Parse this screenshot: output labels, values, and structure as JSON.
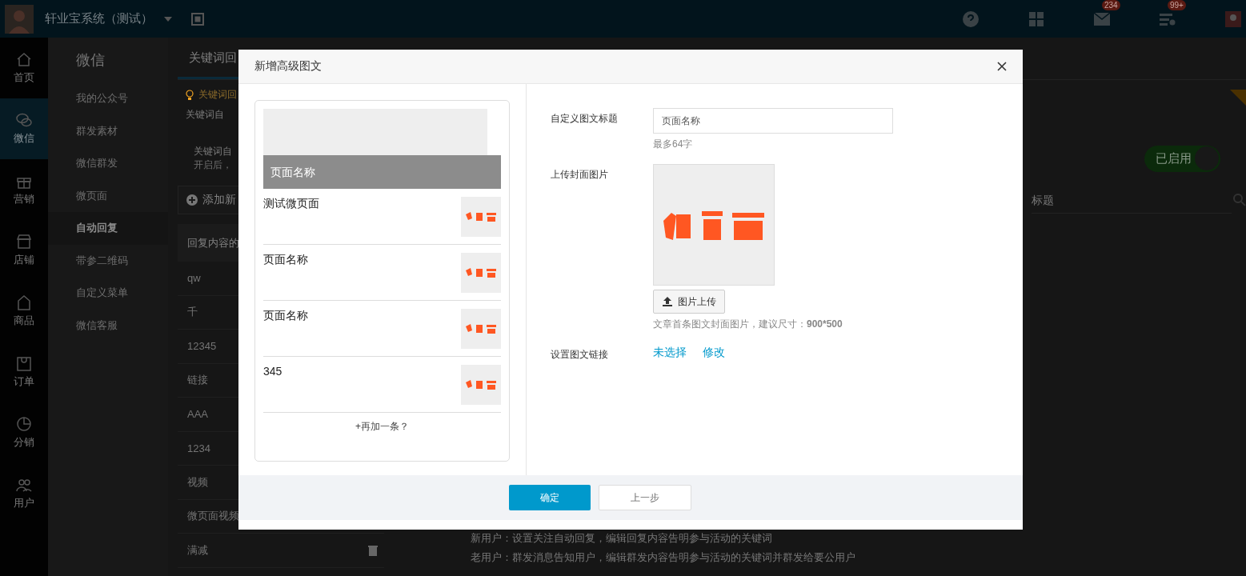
{
  "top_bar": {
    "title": "轩业宝系统（测试）",
    "notifications": [
      {
        "kind": "mail",
        "badge": "234"
      },
      {
        "kind": "tasks",
        "badge": "99+"
      }
    ]
  },
  "nav": [
    {
      "label": "首页",
      "kind": "home",
      "selected": false
    },
    {
      "label": "微信",
      "kind": "chat",
      "selected": true
    },
    {
      "label": "营销",
      "kind": "gift",
      "selected": false
    },
    {
      "label": "店铺",
      "kind": "store",
      "selected": false
    },
    {
      "label": "商品",
      "kind": "tag",
      "selected": false
    },
    {
      "label": "订单",
      "kind": "bag",
      "selected": false
    },
    {
      "label": "分销",
      "kind": "pie",
      "selected": false
    },
    {
      "label": "用户",
      "kind": "users",
      "selected": false
    }
  ],
  "submenu": {
    "title": "微信",
    "items": [
      {
        "label": "我的公众号",
        "selected": false
      },
      {
        "label": "群发素材",
        "selected": false
      },
      {
        "label": "微信群发",
        "selected": false
      },
      {
        "label": "微页面",
        "selected": false
      },
      {
        "label": "自动回复",
        "selected": true
      },
      {
        "label": "带参二维码",
        "selected": false
      },
      {
        "label": "自定义菜单",
        "selected": false
      },
      {
        "label": "微信客服",
        "selected": false
      }
    ]
  },
  "content": {
    "tab": {
      "label": "关键词回",
      "selected": true
    },
    "tip": "关键词回",
    "lines": [
      "关键词自",
      "关键词自",
      "开启后，"
    ],
    "switch": {
      "label": "已启用",
      "on": true
    },
    "add_button": "添加新",
    "search": {
      "placeholder": "标题"
    },
    "table": {
      "header": "回复内容的",
      "rows": [
        "qw",
        "千",
        "12345",
        "链接",
        "AAA",
        "1234",
        "视频",
        "微页面视频",
        "满减"
      ]
    },
    "notes": [
      "新用户：设置关注自动回复，编辑回复内容告明参与活动的关键词",
      "老用户：群发消息告知用户，编辑群发内容告明参与活动的关键词并群发给要公用户"
    ]
  },
  "dialog": {
    "title": "新增高级图文",
    "cover": {
      "title": "页面名称"
    },
    "articles": [
      {
        "title": "测试微页面"
      },
      {
        "title": "页面名称"
      },
      {
        "title": "页面名称"
      },
      {
        "title": "345"
      }
    ],
    "add_more": "+再加一条？",
    "form": {
      "title_label": "自定义图文标题",
      "title_value": "页面名称",
      "title_hint": "最多64字",
      "cover_label": "上传封面图片",
      "upload_button": "图片上传",
      "cover_hint": "文章首条图文封面图片，建议尺寸：**900*500**",
      "link_label": "设置图文链接",
      "links": [
        "未选择",
        "修改"
      ]
    },
    "buttons": [
      {
        "label": "确定",
        "kind": "primary"
      },
      {
        "label": "上一步",
        "kind": "secondary"
      }
    ]
  }
}
